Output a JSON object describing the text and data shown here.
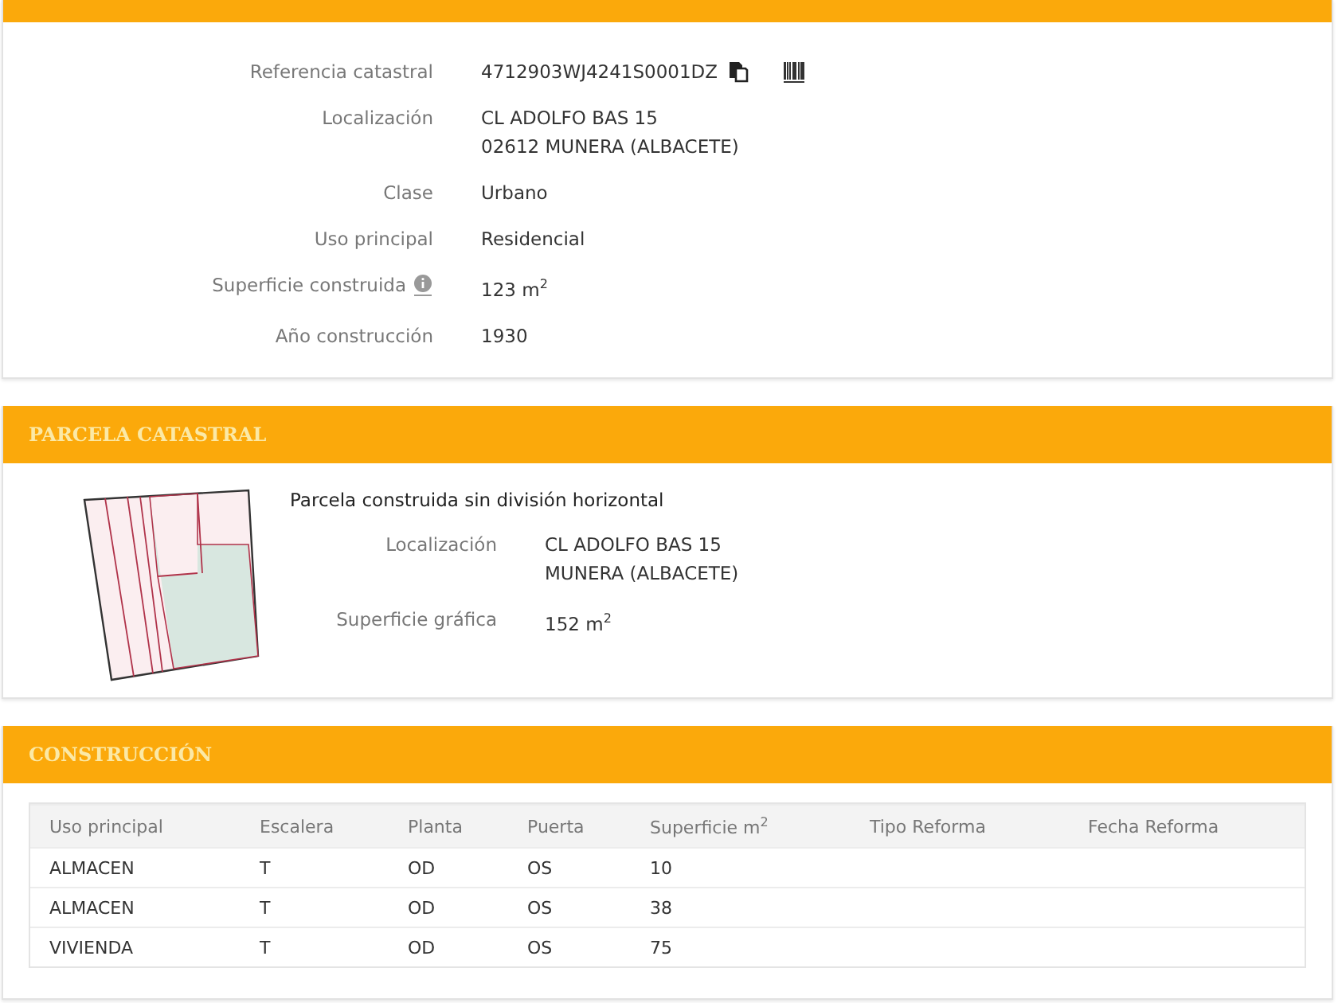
{
  "inmueble": {
    "rows": [
      {
        "label": "Referencia catastral",
        "lines": [
          "4712903WJ4241S0001DZ"
        ],
        "kind": "reference"
      },
      {
        "label": "Localización",
        "lines": [
          "CL ADOLFO BAS 15",
          "02612 MUNERA (ALBACETE)"
        ],
        "kind": "plain"
      },
      {
        "label": "Clase",
        "lines": [
          "Urbano"
        ],
        "kind": "plain"
      },
      {
        "label": "Uso principal",
        "lines": [
          "Residencial"
        ],
        "kind": "plain"
      },
      {
        "label": "Superficie construida",
        "lines": [
          "123 m$^{2}$"
        ],
        "kind": "info"
      },
      {
        "label": "Año construcción",
        "lines": [
          "1930"
        ],
        "kind": "plain"
      }
    ]
  },
  "parcela": {
    "title": "PARCELA CATASTRAL",
    "subtitle": "Parcela construida sin división horizontal",
    "rows": [
      {
        "label": "Localización",
        "lines": [
          "CL ADOLFO BAS 15",
          "MUNERA (ALBACETE)"
        ]
      },
      {
        "label": "Superficie gráfica",
        "lines": [
          "152 m$^{2}$"
        ]
      }
    ]
  },
  "construccion": {
    "title": "CONSTRUCCIÓN",
    "columns": [
      "Uso principal",
      "Escalera",
      "Planta",
      "Puerta",
      "Superficie m$^{2}$",
      "Tipo Reforma",
      "Fecha Reforma"
    ],
    "rows": [
      [
        "ALMACEN",
        "T",
        "OD",
        "OS",
        "10",
        "",
        ""
      ],
      [
        "ALMACEN",
        "T",
        "OD",
        "OS",
        "38",
        "",
        ""
      ],
      [
        "VIVIENDA",
        "T",
        "OD",
        "OS",
        "75",
        "",
        ""
      ]
    ]
  }
}
